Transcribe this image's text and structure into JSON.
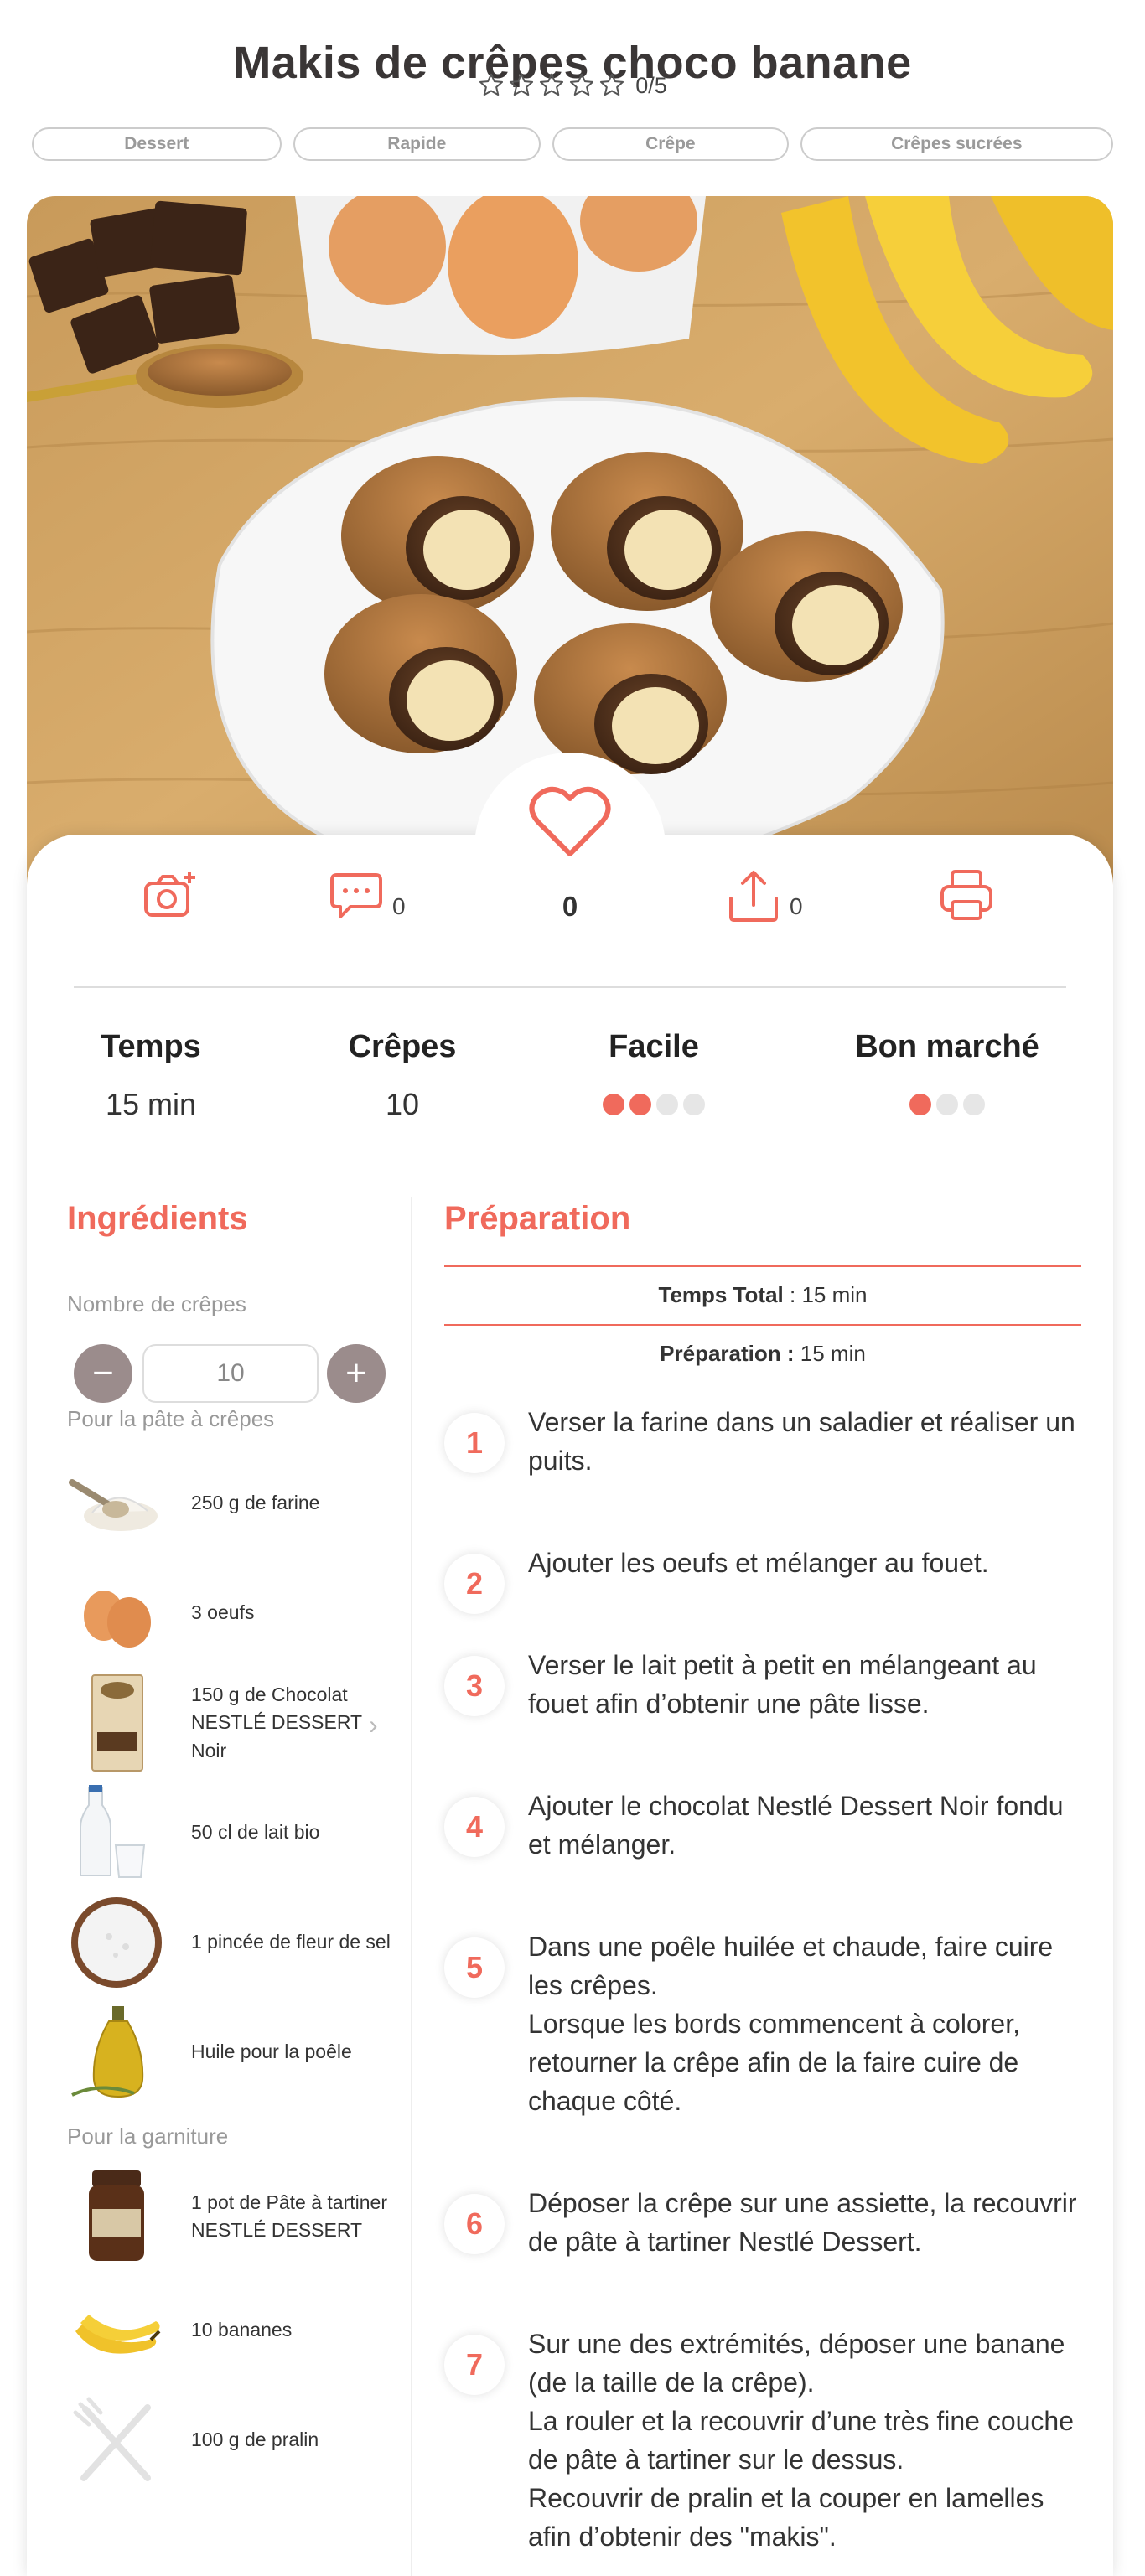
{
  "recipe": {
    "title": "Makis de crêpes choco banane",
    "rating_text": "0/5",
    "tags": [
      "Dessert",
      "Rapide",
      "Crêpe",
      "Crêpes sucrées"
    ]
  },
  "actions": {
    "comments_count": "0",
    "likes_count": "0",
    "shares_count": "0"
  },
  "stats": {
    "time_label": "Temps",
    "time_value": "15 min",
    "yield_label": "Crêpes",
    "yield_value": "10",
    "difficulty_label": "Facile",
    "difficulty_level": 2,
    "difficulty_max": 4,
    "cost_label": "Bon marché",
    "cost_level": 1,
    "cost_max": 3
  },
  "ingredients": {
    "title": "Ingrédients",
    "servings_label": "Nombre de crêpes",
    "servings_value": "10",
    "minus": "−",
    "plus": "+",
    "groups": [
      {
        "label": "Pour la pâte à crêpes",
        "items": [
          {
            "text": "250 g de farine",
            "icon": "flour-icon"
          },
          {
            "text": "3 oeufs",
            "icon": "eggs-icon"
          },
          {
            "text": "150 g de Chocolat NESTLÉ DESSERT Noir",
            "icon": "chocolate-bar-icon"
          },
          {
            "text": "50 cl de lait bio",
            "icon": "milk-icon"
          },
          {
            "text": "1 pincée de fleur de sel",
            "icon": "salt-icon"
          },
          {
            "text": "Huile pour la poêle",
            "icon": "oil-bottle-icon"
          }
        ]
      },
      {
        "label": "Pour la garniture",
        "items": [
          {
            "text": "1 pot de Pâte à tartiner NESTLÉ DESSERT",
            "icon": "spread-jar-icon"
          },
          {
            "text": "10 bananes",
            "icon": "bananas-icon"
          },
          {
            "text": "100 g de pralin",
            "icon": "cutlery-icon"
          }
        ]
      }
    ]
  },
  "preparation": {
    "title": "Préparation",
    "total_label": "Temps Total",
    "total_value": " : 15 min",
    "prep_label": "Préparation :",
    "prep_value": " 15 min",
    "steps": [
      {
        "num": "1",
        "text": "Verser la farine dans un saladier et réaliser un puits."
      },
      {
        "num": "2",
        "text": "Ajouter les oeufs et mélanger au fouet."
      },
      {
        "num": "3",
        "text": "Verser le lait petit à petit en mélangeant au fouet afin d’obtenir une pâte lisse."
      },
      {
        "num": "4",
        "text": "Ajouter le chocolat Nestlé Dessert Noir fondu et mélanger."
      },
      {
        "num": "5",
        "text": "Dans une poêle huilée et chaude, faire cuire les crêpes.\nLorsque les bords commencent à colorer, retourner la crêpe afin de la faire cuire de chaque côté."
      },
      {
        "num": "6",
        "text": "Déposer la crêpe sur une assiette, la recouvrir de pâte à tartiner Nestlé Dessert."
      },
      {
        "num": "7",
        "text": "Sur une des extrémités, déposer une banane (de la taille de la crêpe).\nLa rouler et la recouvrir d’une très fine couche de pâte à tartiner sur le dessus.\nRecouvrir de pralin et la couper en lamelles afin d’obtenir des \"makis\"."
      }
    ]
  },
  "colors": {
    "accent": "#f06a5c",
    "title": "#3a3636",
    "muted": "#999999"
  }
}
